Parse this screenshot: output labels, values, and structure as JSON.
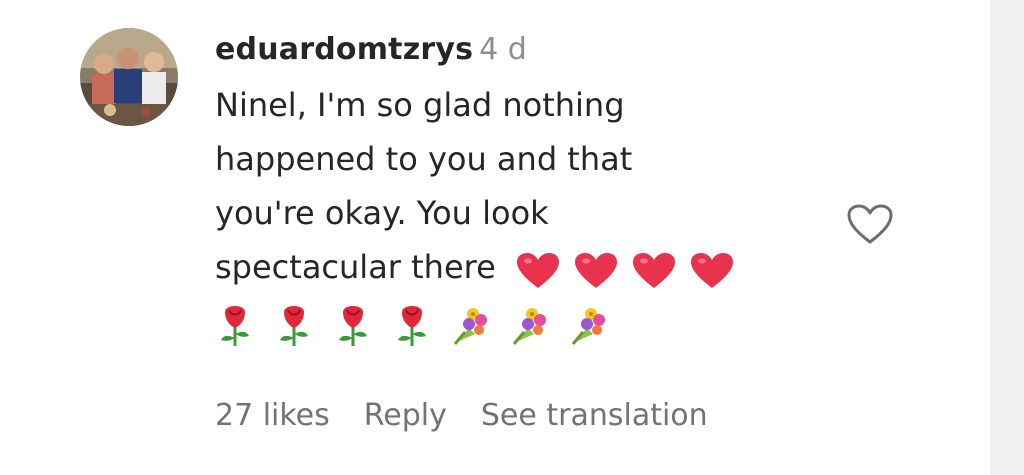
{
  "comment": {
    "username": "eduardomtzrys",
    "time_ago": "4 d",
    "text_lines": [
      "Ninel, I'm so glad nothing",
      "happened to you and that",
      "you're okay. You look",
      "spectacular there"
    ],
    "emoji_line1": [
      "heart",
      "heart",
      "heart",
      "heart"
    ],
    "emoji_line2": [
      "rose",
      "rose",
      "rose",
      "rose",
      "bouquet",
      "bouquet",
      "bouquet"
    ]
  },
  "actions": {
    "likes": "27 likes",
    "reply": "Reply",
    "translate": "See translation"
  },
  "icons": {
    "like": "heart-outline-icon",
    "avatar": "profile-photo"
  },
  "colors": {
    "text": "#262626",
    "muted": "#8e8e8e",
    "heart_emoji": "#e8324e"
  }
}
